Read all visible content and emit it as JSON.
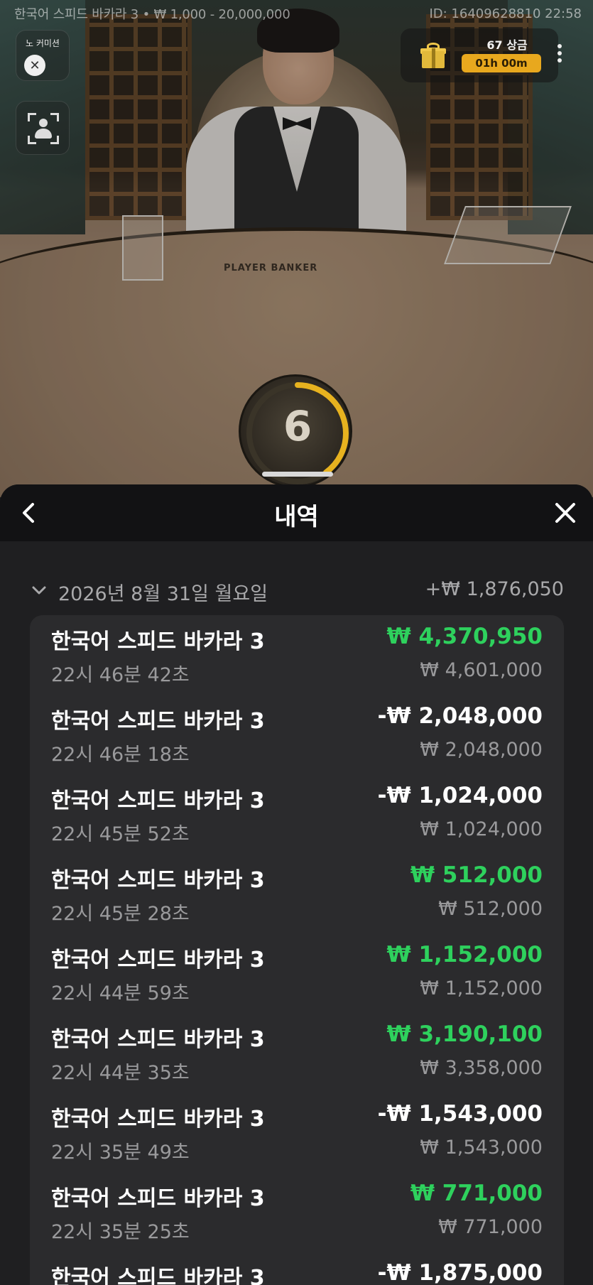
{
  "topbar": {
    "title": "한국어 스피드 바카라 3 • ₩ 1,000 - 20,000,000",
    "id_time": "ID: 16409628810 22:58"
  },
  "no_commission": {
    "label": "노 커미션"
  },
  "table": {
    "printed_text": "PLAYER  BANKER"
  },
  "prize": {
    "count_label": "67 상금",
    "timer": "01h 00m"
  },
  "countdown": {
    "value": "6",
    "progress": 0.4
  },
  "history": {
    "title": "내역",
    "date_label": "2026년 8월 31일 월요일",
    "date_total": "+₩ 1,876,050",
    "rows": [
      {
        "game": "한국어 스피드 바카라 3",
        "time": "22시 46분 42초",
        "amount": "₩ 4,370,950",
        "stake": "₩ 4,601,000",
        "win": true
      },
      {
        "game": "한국어 스피드 바카라 3",
        "time": "22시 46분 18초",
        "amount": "-₩ 2,048,000",
        "stake": "₩ 2,048,000",
        "win": false
      },
      {
        "game": "한국어 스피드 바카라 3",
        "time": "22시 45분 52초",
        "amount": "-₩ 1,024,000",
        "stake": "₩ 1,024,000",
        "win": false
      },
      {
        "game": "한국어 스피드 바카라 3",
        "time": "22시 45분 28초",
        "amount": "₩ 512,000",
        "stake": "₩ 512,000",
        "win": true
      },
      {
        "game": "한국어 스피드 바카라 3",
        "time": "22시 44분 59초",
        "amount": "₩ 1,152,000",
        "stake": "₩ 1,152,000",
        "win": true
      },
      {
        "game": "한국어 스피드 바카라 3",
        "time": "22시 44분 35초",
        "amount": "₩ 3,190,100",
        "stake": "₩ 3,358,000",
        "win": true
      },
      {
        "game": "한국어 스피드 바카라 3",
        "time": "22시 35분 49초",
        "amount": "-₩ 1,543,000",
        "stake": "₩ 1,543,000",
        "win": false
      },
      {
        "game": "한국어 스피드 바카라 3",
        "time": "22시 35분 25초",
        "amount": "₩ 771,000",
        "stake": "₩ 771,000",
        "win": true
      },
      {
        "game": "한국어 스피드 바카라 3",
        "time": "",
        "amount": "-₩ 1,875,000",
        "stake": "",
        "win": false
      }
    ]
  },
  "colors": {
    "win": "#2ed15d",
    "accent": "#e8a81e",
    "sheet_bg": "#1f1f21",
    "card_bg": "#2b2b2d"
  }
}
